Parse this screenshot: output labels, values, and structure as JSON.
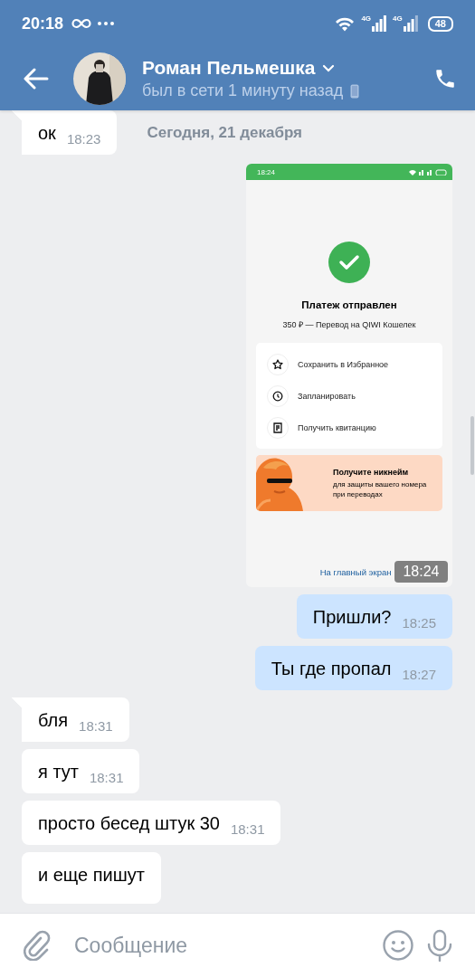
{
  "status_bar": {
    "time": "20:18",
    "network_1": "4G",
    "network_2": "4G",
    "battery": "48"
  },
  "header": {
    "name": "Роман Пельмешка",
    "status": "был в сети 1 минуту назад"
  },
  "date_label": "Сегодня, 21 декабря",
  "messages": [
    {
      "kind": "text",
      "outgoing": false,
      "text": "ок",
      "time": "18:23",
      "tail": true
    },
    {
      "time": "18:24",
      "screenshot": {
        "status_time": "18:24",
        "title": "Платеж отправлен",
        "subtitle": "350 ₽ — Перевод на QIWI Кошелек",
        "actions": [
          {
            "label": "Сохранить в Избранное"
          },
          {
            "label": "Запланировать"
          },
          {
            "label": "Получить квитанцию"
          }
        ],
        "promo": {
          "title": "Получите никнейм",
          "text": "для защиты вашего номера при переводах"
        },
        "link": "На главный экран"
      }
    },
    {
      "kind": "text",
      "outgoing": true,
      "text": "Пришли?",
      "time": "18:25",
      "tail": false
    },
    {
      "kind": "text",
      "outgoing": true,
      "text": "Ты где пропал",
      "time": "18:27",
      "tail": false
    },
    {
      "kind": "text",
      "outgoing": false,
      "text": "бля",
      "time": "18:31",
      "tail": true
    },
    {
      "kind": "text",
      "outgoing": false,
      "text": "я тут",
      "time": "18:31",
      "tail": false
    },
    {
      "kind": "text",
      "outgoing": false,
      "text": "просто бесед штук 30",
      "time": "18:31",
      "tail": false
    },
    {
      "kind": "text",
      "outgoing": false,
      "text": "и еще пишут",
      "tail": false
    }
  ],
  "composer": {
    "placeholder": "Сообщение"
  }
}
